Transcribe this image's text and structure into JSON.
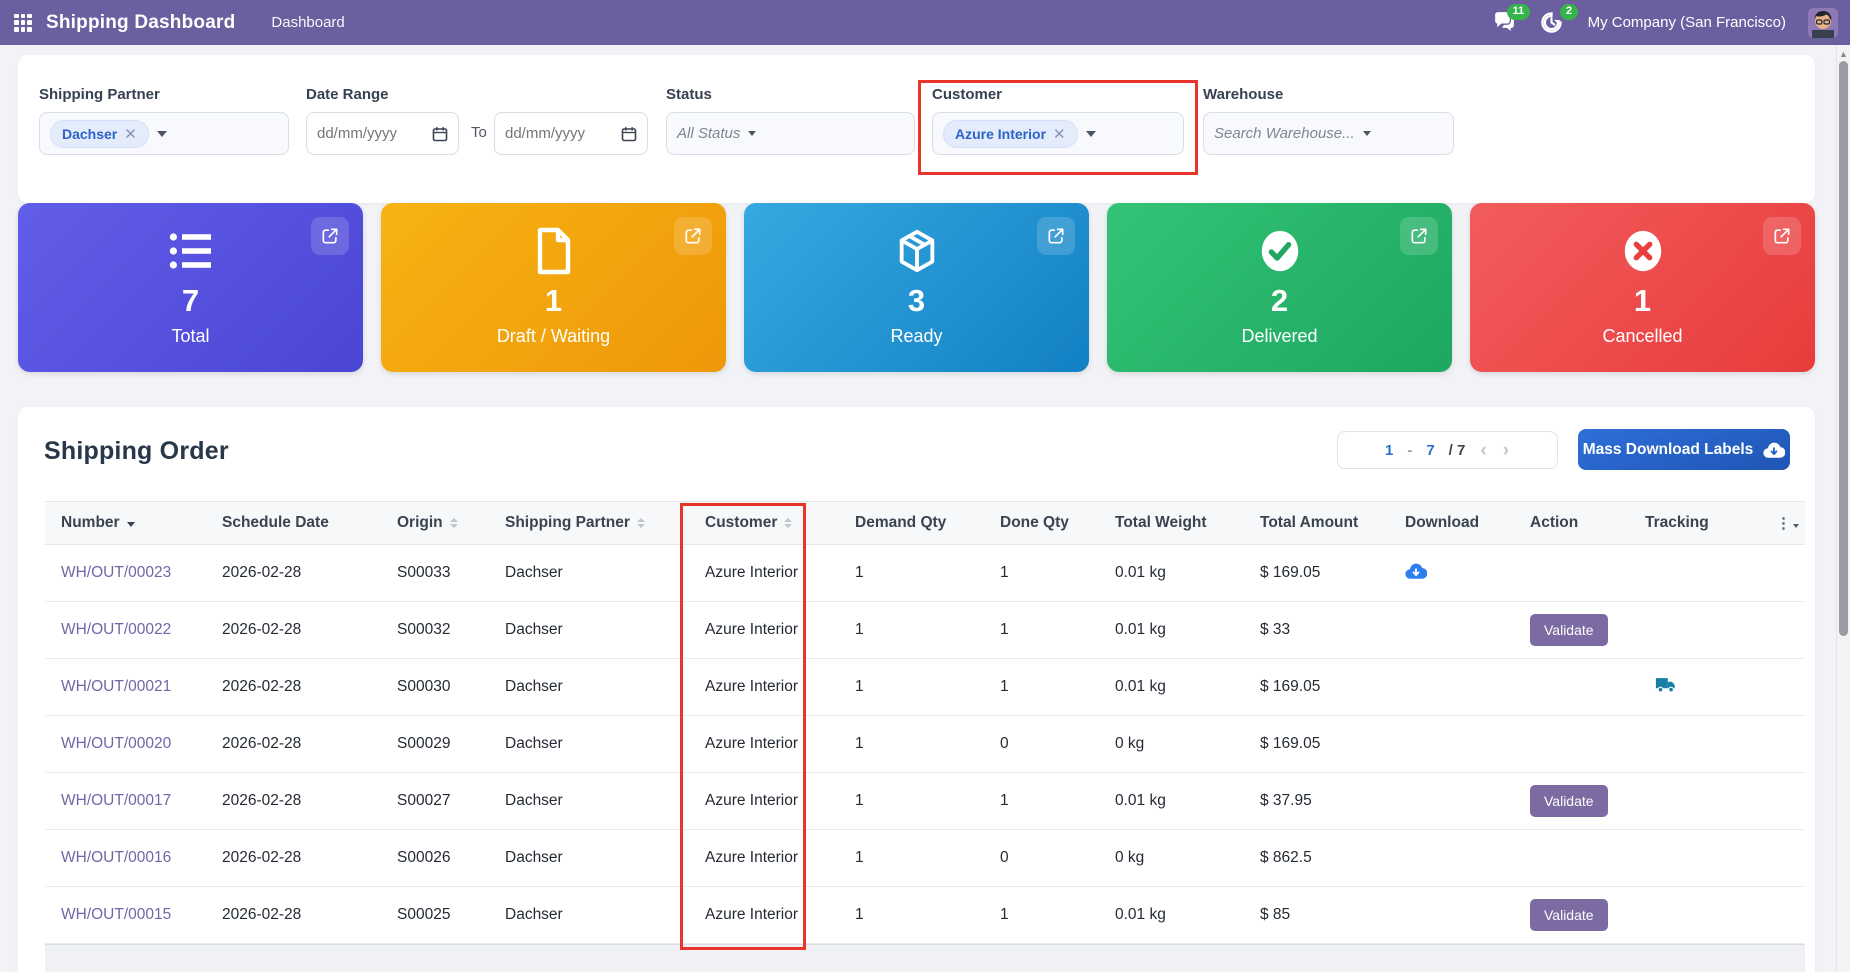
{
  "navbar": {
    "app_title": "Shipping Dashboard",
    "menu_item": "Dashboard",
    "messages_badge": "11",
    "activities_badge": "2",
    "company": "My Company (San Francisco)",
    "bg_color": "#6b5f9f",
    "badge_color": "#34b44a"
  },
  "filters": {
    "shipping_partner": {
      "label": "Shipping Partner",
      "selected_tag": "Dachser"
    },
    "date_range": {
      "label": "Date Range",
      "from_placeholder": "dd/mm/yyyy",
      "to_label": "To",
      "to_placeholder": "dd/mm/yyyy"
    },
    "status": {
      "label": "Status",
      "value": "All Status"
    },
    "customer": {
      "label": "Customer",
      "selected_tag": "Azure Interior"
    },
    "warehouse": {
      "label": "Warehouse",
      "placeholder": "Search Warehouse..."
    }
  },
  "annotations": {
    "color": "#e8352b",
    "highlighted": [
      "customer-filter",
      "customer-column"
    ]
  },
  "cards": [
    {
      "value": "7",
      "label": "Total",
      "icon": "list-icon",
      "color": "#5652df"
    },
    {
      "value": "1",
      "label": "Draft / Waiting",
      "icon": "file-icon",
      "color": "#f3a60e"
    },
    {
      "value": "3",
      "label": "Ready",
      "icon": "package-icon",
      "color": "#2496d2"
    },
    {
      "value": "2",
      "label": "Delivered",
      "icon": "check-circle-icon",
      "color": "#28b56b"
    },
    {
      "value": "1",
      "label": "Cancelled",
      "icon": "x-circle-icon",
      "color": "#ee4a4a"
    }
  ],
  "orders": {
    "title": "Shipping Order",
    "pagination": {
      "start": "1",
      "dash": "-",
      "end": "7",
      "total": "/ 7"
    },
    "mass_download_label": "Mass Download Labels",
    "validate_label": "Validate",
    "columns": [
      {
        "label": "Number",
        "sort": "desc"
      },
      {
        "label": "Schedule Date",
        "sort": null
      },
      {
        "label": "Origin",
        "sort": "both"
      },
      {
        "label": "Shipping Partner",
        "sort": "both"
      },
      {
        "label": "Customer",
        "sort": "both"
      },
      {
        "label": "Demand Qty",
        "sort": null
      },
      {
        "label": "Done Qty",
        "sort": null
      },
      {
        "label": "Total Weight",
        "sort": null
      },
      {
        "label": "Total Amount",
        "sort": null
      },
      {
        "label": "Download",
        "sort": null
      },
      {
        "label": "Action",
        "sort": null
      },
      {
        "label": "Tracking",
        "sort": null
      }
    ],
    "rows": [
      {
        "number": "WH/OUT/00023",
        "schedule_date": "2026-02-28",
        "origin": "S00033",
        "shipping_partner": "Dachser",
        "customer": "Azure Interior",
        "demand_qty": "1",
        "done_qty": "1",
        "total_weight": "0.01 kg",
        "total_amount": "$ 169.05",
        "has_download": true,
        "has_validate": false,
        "has_tracking": false
      },
      {
        "number": "WH/OUT/00022",
        "schedule_date": "2026-02-28",
        "origin": "S00032",
        "shipping_partner": "Dachser",
        "customer": "Azure Interior",
        "demand_qty": "1",
        "done_qty": "1",
        "total_weight": "0.01 kg",
        "total_amount": "$ 33",
        "has_download": false,
        "has_validate": true,
        "has_tracking": false
      },
      {
        "number": "WH/OUT/00021",
        "schedule_date": "2026-02-28",
        "origin": "S00030",
        "shipping_partner": "Dachser",
        "customer": "Azure Interior",
        "demand_qty": "1",
        "done_qty": "1",
        "total_weight": "0.01 kg",
        "total_amount": "$ 169.05",
        "has_download": false,
        "has_validate": false,
        "has_tracking": true
      },
      {
        "number": "WH/OUT/00020",
        "schedule_date": "2026-02-28",
        "origin": "S00029",
        "shipping_partner": "Dachser",
        "customer": "Azure Interior",
        "demand_qty": "1",
        "done_qty": "0",
        "total_weight": "0 kg",
        "total_amount": "$ 169.05",
        "has_download": false,
        "has_validate": false,
        "has_tracking": false
      },
      {
        "number": "WH/OUT/00017",
        "schedule_date": "2026-02-28",
        "origin": "S00027",
        "shipping_partner": "Dachser",
        "customer": "Azure Interior",
        "demand_qty": "1",
        "done_qty": "1",
        "total_weight": "0.01 kg",
        "total_amount": "$ 37.95",
        "has_download": false,
        "has_validate": true,
        "has_tracking": false
      },
      {
        "number": "WH/OUT/00016",
        "schedule_date": "2026-02-28",
        "origin": "S00026",
        "shipping_partner": "Dachser",
        "customer": "Azure Interior",
        "demand_qty": "1",
        "done_qty": "0",
        "total_weight": "0 kg",
        "total_amount": "$ 862.5",
        "has_download": false,
        "has_validate": false,
        "has_tracking": false
      },
      {
        "number": "WH/OUT/00015",
        "schedule_date": "2026-02-28",
        "origin": "S00025",
        "shipping_partner": "Dachser",
        "customer": "Azure Interior",
        "demand_qty": "1",
        "done_qty": "1",
        "total_weight": "0.01 kg",
        "total_amount": "$ 85",
        "has_download": false,
        "has_validate": true,
        "has_tracking": false
      }
    ]
  }
}
